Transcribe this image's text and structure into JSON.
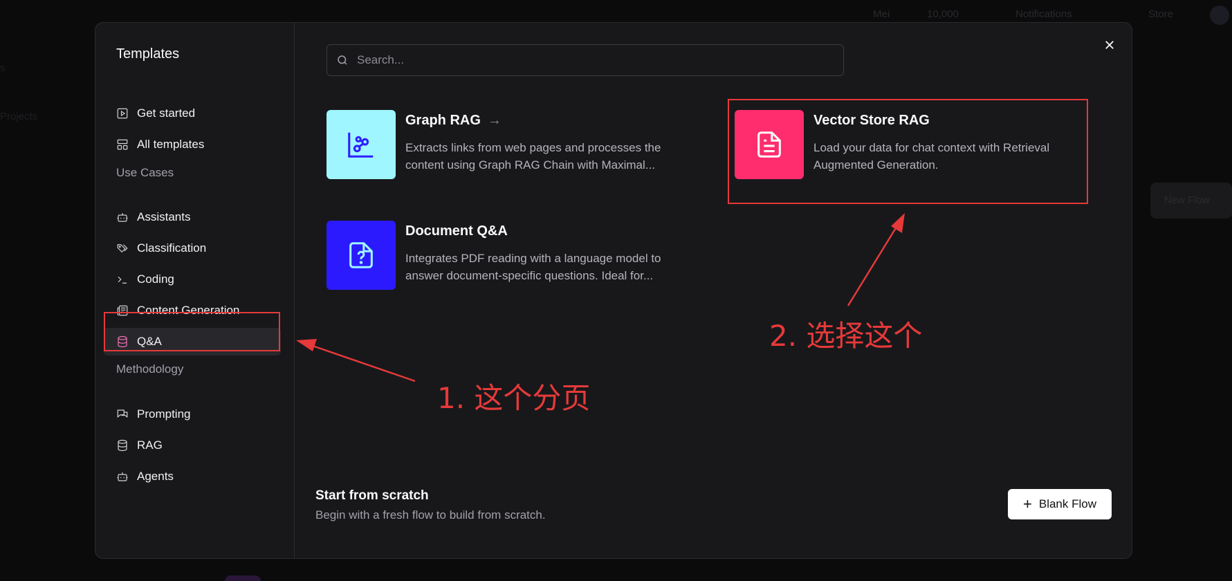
{
  "background": {
    "topbar": [
      "Mei",
      "10,000",
      "Notifications",
      "Store"
    ],
    "sidebar": [
      "s",
      "Projects"
    ],
    "new_flow": "New Flow"
  },
  "modal": {
    "sidebar": {
      "title": "Templates",
      "items_top": [
        {
          "label": "Get started",
          "icon": "play-square-icon"
        },
        {
          "label": "All templates",
          "icon": "layout-panel-icon"
        }
      ],
      "section_use_cases": "Use Cases",
      "use_cases": [
        {
          "label": "Assistants",
          "icon": "bot-icon"
        },
        {
          "label": "Classification",
          "icon": "tags-icon"
        },
        {
          "label": "Coding",
          "icon": "terminal-icon"
        },
        {
          "label": "Content Generation",
          "icon": "newspaper-icon"
        },
        {
          "label": "Q&A",
          "icon": "database-icon",
          "active": true
        }
      ],
      "section_methodology": "Methodology",
      "methodology": [
        {
          "label": "Prompting",
          "icon": "messages-icon"
        },
        {
          "label": "RAG",
          "icon": "database-icon"
        },
        {
          "label": "Agents",
          "icon": "bot-icon"
        }
      ]
    },
    "search": {
      "placeholder": "Search..."
    },
    "cards": [
      {
        "title": "Graph RAG",
        "arrow": "→",
        "description": "Extracts links from web pages and processes the content using Graph RAG Chain with Maximal...",
        "icon": "chart-scatter-icon",
        "thumb_color": "#9ff6ff",
        "icon_color": "#2d1fff"
      },
      {
        "title": "Vector Store RAG",
        "description": "Load your data for chat context with Retrieval Augmented Generation.",
        "icon": "file-text-icon",
        "thumb_color": "#ff2d6e",
        "icon_color": "#ffffff"
      },
      {
        "title": "Document Q&A",
        "description": "Integrates PDF reading with a language model to answer document-specific questions. Ideal for...",
        "icon": "file-question-icon",
        "thumb_color": "#2c1aff",
        "icon_color": "#9ff6ff"
      }
    ],
    "scratch": {
      "title": "Start from scratch",
      "subtitle": "Begin with a fresh flow to build from scratch.",
      "button": "Blank Flow"
    }
  },
  "annotations": {
    "step1": "1. 这个分页",
    "step2": "2. 选择这个",
    "color": "#e63939"
  }
}
